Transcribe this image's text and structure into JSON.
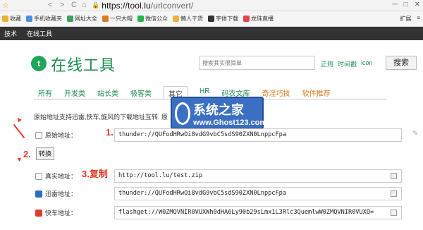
{
  "browser": {
    "url_host": "https://tool.lu",
    "url_path": "/urlconvert/",
    "nav_star": "☆",
    "nav_back": "<",
    "nav_forward": ">",
    "nav_reload": "C",
    "nav_home": "⌂",
    "win_controls": [
      "─",
      "□",
      "✕"
    ]
  },
  "bookmarks": {
    "items": [
      {
        "label": "收藏",
        "icon": "star-icon",
        "color": "#f0b030"
      },
      {
        "label": "手机收藏夹",
        "icon": "phone-icon",
        "color": "#4a90e2"
      },
      {
        "label": "网址大全",
        "icon": "globe-icon",
        "color": "#3aa55a"
      },
      {
        "label": "一只大帽",
        "icon": "plus-icon",
        "color": "#e07a20"
      },
      {
        "label": "微信公众",
        "icon": "wechat-icon",
        "color": "#2ab34a"
      },
      {
        "label": "懒人干货",
        "icon": "folder-icon",
        "color": "#e6b53a"
      },
      {
        "label": "字体下载",
        "icon": "font-icon",
        "color": "#333333"
      },
      {
        "label": "龙珠直播",
        "icon": "live-icon",
        "color": "#e04848"
      }
    ],
    "right": [
      "扩展",
      "≡"
    ]
  },
  "sitebar": {
    "items": [
      "技术",
      "在线工具"
    ]
  },
  "header": {
    "logo_letter": "t",
    "logo_text": "在线工具",
    "search_placeholder": "搜索其实很简单",
    "filters": [
      "正则",
      "时间戳",
      "icon"
    ],
    "search_button": "搜索"
  },
  "tabs": [
    {
      "label": "所有",
      "style": "normal"
    },
    {
      "label": "开发类",
      "style": "normal"
    },
    {
      "label": "站长类",
      "style": "normal"
    },
    {
      "label": "极客类",
      "style": "normal"
    },
    {
      "label": "其它",
      "style": "active"
    },
    {
      "label": "HR",
      "style": "normal"
    },
    {
      "label": "码农文库",
      "style": "normal"
    },
    {
      "label": "奇淫巧技",
      "style": "orange"
    },
    {
      "label": "软件推荐",
      "style": "orange"
    }
  ],
  "description": "原始地址支持迅雷,快车,旋风的下载地址互转. 原",
  "watermark": {
    "title": "系统之家",
    "url": "www.Ghost123.com"
  },
  "form": {
    "original_label": "原始地址：",
    "original_value": "thunder://QUFodHRwOi8vdG9vbC5sdS90ZXN0LnppcFpa",
    "convert_button": "转换",
    "rows": [
      {
        "label": "真实地址：",
        "value": "http://tool.lu/test.zip",
        "icon": "checkbox-icon",
        "color": "#ffffff"
      },
      {
        "label": "迅雷地址：",
        "value": "thunder://QUFodHRwOi8vdG9vbC5sdS90ZXN0LnppcFpa",
        "icon": "thunder-icon",
        "color": "#2a6bc8"
      },
      {
        "label": "快车地址：",
        "value": "flashget://W0ZMQVNIR0VUXWh0dHA6Ly90b29sLmx1L3Rlc3QuemlwW0ZMQVNIR0VUXQ=",
        "icon": "flashget-icon",
        "color": "#d8402a"
      }
    ]
  },
  "annotations": {
    "step1": "1.",
    "step2": "2.",
    "step3": "3.复制"
  }
}
